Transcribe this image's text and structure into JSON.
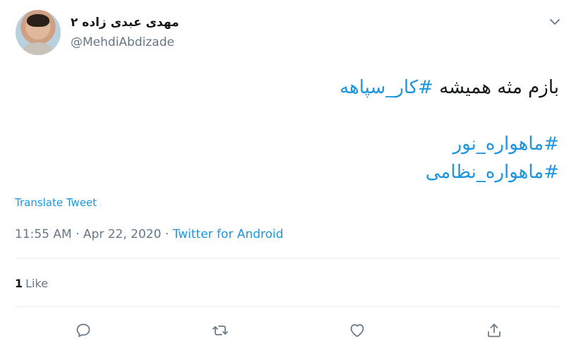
{
  "author": {
    "display_name": "مهدی عبدی زاده ۲",
    "handle": "@MehdiAbdizade"
  },
  "tweet": {
    "line1_text": "بازم مثه همیشه ",
    "line1_hashtag": "#کار_سپاهه",
    "line2_hashtag": "#ماهواره_نور",
    "line3_hashtag": "#ماهواره_نظامی"
  },
  "translate_label": "Translate Tweet",
  "meta": {
    "time": "11:55 AM",
    "separator1": " · ",
    "date": "Apr 22, 2020",
    "separator2": " · ",
    "source": "Twitter for Android"
  },
  "stats": {
    "like_count": "1",
    "like_label": "Like"
  },
  "icons": {
    "menu": "chevron-down-icon",
    "reply": "reply-icon",
    "retweet": "retweet-icon",
    "like": "heart-icon",
    "share": "share-icon"
  },
  "colors": {
    "accent": "#1b95e0",
    "secondary_text": "#657786",
    "divider": "#e6ecf0"
  }
}
